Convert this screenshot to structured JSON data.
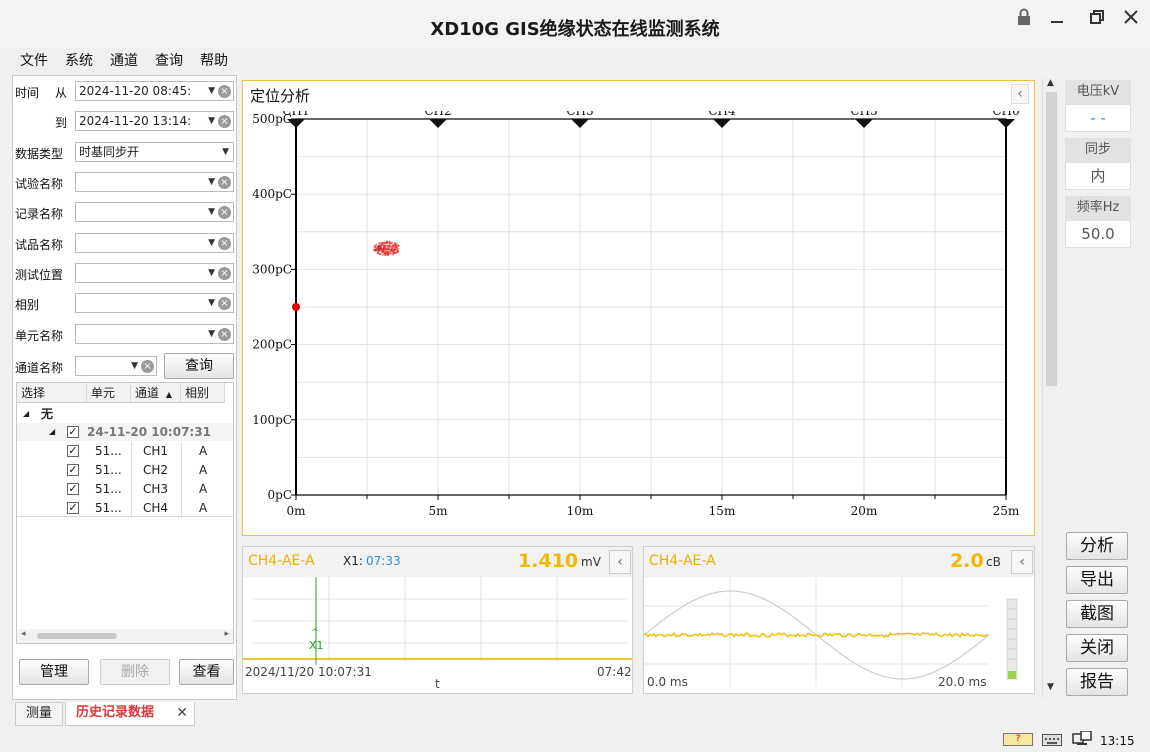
{
  "window": {
    "title": "XD10G GIS绝缘状态在线监测系统"
  },
  "menu": [
    "文件",
    "系统",
    "通道",
    "查询",
    "帮助"
  ],
  "filters": {
    "time_label": "时间",
    "from_label": "从",
    "from_value": "2024-11-20 08:45:",
    "to_label": "到",
    "to_value": "2024-11-20 13:14:",
    "data_type_label": "数据类型",
    "data_type_value": "时基同步开",
    "test_name_label": "试验名称",
    "record_name_label": "记录名称",
    "item_name_label": "试品名称",
    "position_label": "测试位置",
    "phase_label": "相别",
    "unit_name_label": "单元名称",
    "channel_name_label": "通道名称",
    "query_button": "查询"
  },
  "grid": {
    "headers": [
      "选择",
      "单元",
      "通道",
      "相别"
    ],
    "group": "无",
    "subgroup": "24-11-20 10:07:31",
    "rows": [
      {
        "unit": "51...",
        "channel": "CH1",
        "phase": "A"
      },
      {
        "unit": "51...",
        "channel": "CH2",
        "phase": "A"
      },
      {
        "unit": "51...",
        "channel": "CH3",
        "phase": "A"
      },
      {
        "unit": "51...",
        "channel": "CH4",
        "phase": "A"
      }
    ]
  },
  "left_buttons": {
    "manage": "管理",
    "delete": "删除",
    "view": "查看"
  },
  "locate_panel": {
    "title": "定位分析",
    "collapse": "‹"
  },
  "chart_data": {
    "type": "scatter",
    "title": "",
    "xlabel": "",
    "ylabel": "",
    "xlim": [
      0,
      25
    ],
    "ylim": [
      0,
      500
    ],
    "x_ticks": [
      "0m",
      "5m",
      "10m",
      "15m",
      "20m",
      "25m"
    ],
    "y_ticks": [
      "0pC",
      "100pC",
      "200pC",
      "300pC",
      "400pC",
      "500pC"
    ],
    "channel_markers": [
      {
        "name": "CH1",
        "x": 0
      },
      {
        "name": "CH2",
        "x": 5
      },
      {
        "name": "CH3",
        "x": 10
      },
      {
        "name": "CH4",
        "x": 15
      },
      {
        "name": "CH5",
        "x": 20
      },
      {
        "name": "CH6",
        "x": 25
      }
    ],
    "cluster": {
      "x": 3.2,
      "y": 328,
      "color": "#e02020"
    },
    "point": {
      "x": 0,
      "y": 250,
      "color": "#e00000"
    },
    "grid": true
  },
  "wave_panel": {
    "channel": "CH4-AE-A",
    "cursor_label": "X1:",
    "cursor_time": "07:33",
    "value": "1.410",
    "unit": "mV",
    "marker": "X1",
    "start_time": "2024/11/20 10:07:31",
    "end_time": "07:42",
    "axis_label": "t"
  },
  "prpd_panel": {
    "channel": "CH4-AE-A",
    "value": "2.0",
    "unit": "cB",
    "t_start": "0.0 ms",
    "t_end": "20.0 ms"
  },
  "side": {
    "voltage_label": "电压kV",
    "voltage_value": "- -",
    "sync_label": "同步",
    "sync_value": "内",
    "freq_label": "频率Hz",
    "freq_value": "50.0",
    "buttons": [
      "分析",
      "导出",
      "截图",
      "关闭",
      "报告"
    ]
  },
  "tabs": {
    "measure": "测量",
    "history": "历史记录数据"
  },
  "status": {
    "clock": "13:15"
  }
}
